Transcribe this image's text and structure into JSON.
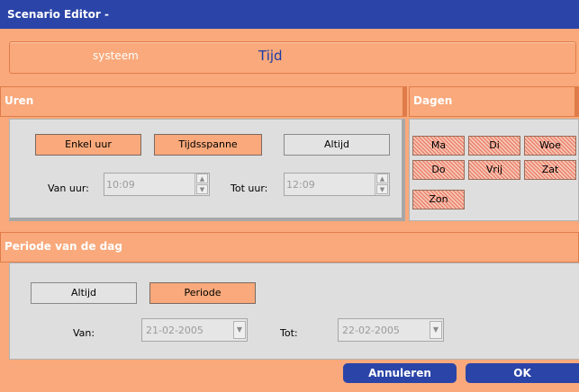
{
  "window": {
    "title": "Scenario Editor -"
  },
  "tabs": {
    "systeem": "systeem",
    "tijd": "Tijd"
  },
  "uren": {
    "title": "Uren",
    "buttons": {
      "enkel_uur": "Enkel uur",
      "tijdsspanne": "Tijdsspanne",
      "altijd": "Altijd"
    },
    "selected": "Altijd",
    "van_label": "Van uur:",
    "van_value": "10:09",
    "tot_label": "Tot uur:",
    "tot_value": "12:09"
  },
  "dagen": {
    "title": "Dagen",
    "days": [
      "Ma",
      "Di",
      "Woe",
      "Do",
      "Vrij",
      "Zat",
      "Zon"
    ]
  },
  "periode": {
    "title": "Periode van de dag",
    "buttons": {
      "altijd": "Altijd",
      "periode": "Periode"
    },
    "selected": "Altijd",
    "van_label": "Van:",
    "van_value": "21-02-2005",
    "tot_label": "Tot:",
    "tot_value": "22-02-2005"
  },
  "footer": {
    "cancel": "Annuleren",
    "ok": "OK"
  },
  "colors": {
    "accent": "#2a44a8",
    "orange": "#f9a97b",
    "panel": "#dedede"
  },
  "icons": {
    "spin_up": "arrow-up-icon",
    "spin_down": "arrow-down-icon",
    "dropdown": "chevron-down-icon"
  }
}
